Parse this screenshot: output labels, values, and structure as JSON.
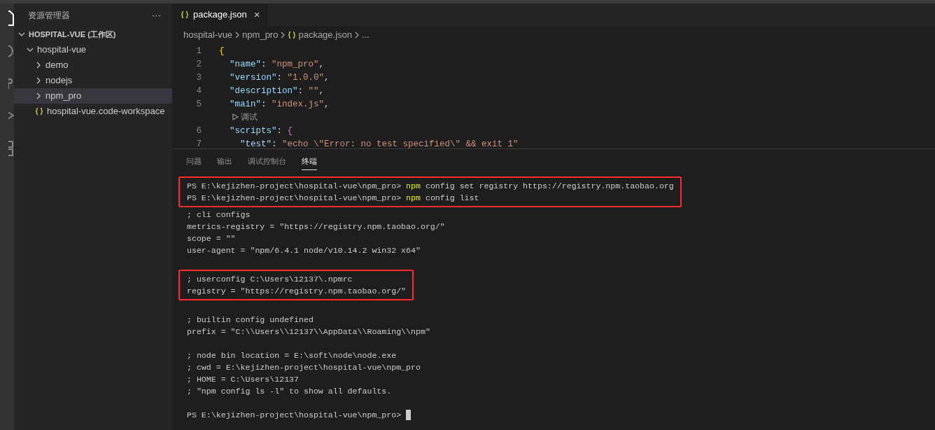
{
  "sidebar": {
    "title": "资源管理器",
    "more": "···",
    "tree": [
      {
        "label": "HOSPITAL-VUE (工作区)",
        "kind": "root",
        "expanded": true,
        "selected": false,
        "children": [
          {
            "label": "hospital-vue",
            "kind": "folder",
            "expanded": true,
            "selected": false,
            "children": [
              {
                "label": "demo",
                "kind": "folder",
                "expanded": false,
                "selected": false
              },
              {
                "label": "nodejs",
                "kind": "folder",
                "expanded": false,
                "selected": false
              },
              {
                "label": "npm_pro",
                "kind": "folder",
                "expanded": false,
                "selected": true
              },
              {
                "label": "hospital-vue.code-workspace",
                "kind": "json",
                "selected": false
              }
            ]
          }
        ]
      }
    ]
  },
  "tabs": [
    {
      "label": "package.json",
      "selected": true,
      "close": "×"
    }
  ],
  "breadcrumbs": [
    {
      "label": "hospital-vue",
      "kind": "text"
    },
    {
      "label": "npm_pro",
      "kind": "text"
    },
    {
      "label": "package.json",
      "kind": "json"
    },
    {
      "label": "...",
      "kind": "text"
    }
  ],
  "editor": {
    "lines": [
      {
        "number": "1",
        "tokens": [
          {
            "kind": "brace",
            "text": "{"
          }
        ]
      },
      {
        "number": "2",
        "tokens": [
          {
            "kind": "key",
            "text": "  \"name\""
          },
          {
            "kind": "punct",
            "text": ": "
          },
          {
            "kind": "string",
            "text": "\"npm_pro\""
          },
          {
            "kind": "punct",
            "text": ","
          }
        ]
      },
      {
        "number": "3",
        "tokens": [
          {
            "kind": "key",
            "text": "  \"version\""
          },
          {
            "kind": "punct",
            "text": ": "
          },
          {
            "kind": "string",
            "text": "\"1.0.0\""
          },
          {
            "kind": "punct",
            "text": ","
          }
        ]
      },
      {
        "number": "4",
        "tokens": [
          {
            "kind": "key",
            "text": "  \"description\""
          },
          {
            "kind": "punct",
            "text": ": "
          },
          {
            "kind": "string",
            "text": "\"\""
          },
          {
            "kind": "punct",
            "text": ","
          }
        ]
      },
      {
        "number": "5",
        "tokens": [
          {
            "kind": "key",
            "text": "  \"main\""
          },
          {
            "kind": "punct",
            "text": ": "
          },
          {
            "kind": "string",
            "text": "\"index.js\""
          },
          {
            "kind": "punct",
            "text": ","
          }
        ]
      },
      {
        "codelens": "调试"
      },
      {
        "number": "6",
        "tokens": [
          {
            "kind": "key",
            "text": "  \"scripts\""
          },
          {
            "kind": "punct",
            "text": ": "
          },
          {
            "kind": "brace2",
            "text": "{"
          }
        ]
      },
      {
        "number": "7",
        "tokens": [
          {
            "kind": "key",
            "text": "    \"test\""
          },
          {
            "kind": "punct",
            "text": ": "
          },
          {
            "kind": "string",
            "text": "\"echo \\\"Error: no test specified\\\" && exit 1\""
          }
        ]
      }
    ]
  },
  "panel": {
    "tabs": [
      {
        "label": "问题",
        "selected": false
      },
      {
        "label": "输出",
        "selected": false
      },
      {
        "label": "调试控制台",
        "selected": false
      },
      {
        "label": "终端",
        "selected": true
      }
    ],
    "terminal": [
      {
        "highlighted": true,
        "lines": [
          {
            "kind": "command",
            "prompt": "PS E:\\kejizhen-project\\hospital-vue\\npm_pro>",
            "command": "npm",
            "args": "config set registry https://registry.npm.taobao.org"
          },
          {
            "kind": "command",
            "prompt": "PS E:\\kejizhen-project\\hospital-vue\\npm_pro>",
            "command": "npm",
            "args": "config list"
          }
        ]
      },
      {
        "highlighted": false,
        "lines": [
          {
            "kind": "output",
            "text": "; cli configs"
          },
          {
            "kind": "output",
            "text": "metrics-registry = \"https://registry.npm.taobao.org/\""
          },
          {
            "kind": "output",
            "text": "scope = \"\""
          },
          {
            "kind": "output",
            "text": "user-agent = \"npm/6.4.1 node/v10.14.2 win32 x64\""
          },
          {
            "kind": "blank"
          }
        ]
      },
      {
        "highlighted": true,
        "lines": [
          {
            "kind": "output",
            "text": "; userconfig C:\\Users\\12137\\.npmrc"
          },
          {
            "kind": "output",
            "text": "registry = \"https://registry.npm.taobao.org/\""
          }
        ]
      },
      {
        "highlighted": false,
        "lines": [
          {
            "kind": "blank"
          },
          {
            "kind": "output",
            "text": "; builtin config undefined"
          },
          {
            "kind": "output",
            "text": "prefix = \"C:\\\\Users\\\\12137\\\\AppData\\\\Roaming\\\\npm\""
          },
          {
            "kind": "blank"
          },
          {
            "kind": "output",
            "text": "; node bin location = E:\\soft\\node\\node.exe"
          },
          {
            "kind": "output",
            "text": "; cwd = E:\\kejizhen-project\\hospital-vue\\npm_pro"
          },
          {
            "kind": "output",
            "text": "; HOME = C:\\Users\\12137"
          },
          {
            "kind": "output",
            "text": "; \"npm config ls -l\" to show all defaults."
          },
          {
            "kind": "blank"
          },
          {
            "kind": "prompt",
            "prompt": "PS E:\\kejizhen-project\\hospital-vue\\npm_pro>",
            "cursor": true
          }
        ]
      }
    ]
  }
}
